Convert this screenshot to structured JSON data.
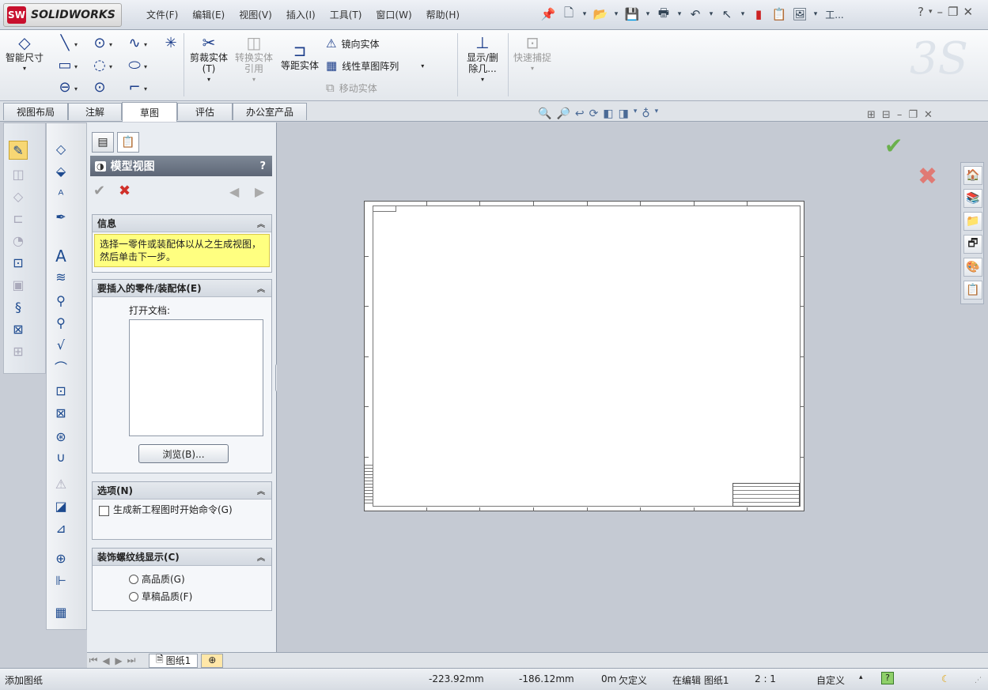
{
  "app": {
    "brand": "SOLIDWORKS",
    "logo_mark": "SW"
  },
  "menu": [
    "文件(F)",
    "编辑(E)",
    "视图(V)",
    "插入(I)",
    "工具(T)",
    "窗口(W)",
    "帮助(H)"
  ],
  "quick_access": {
    "pin_icon": "pin-icon",
    "overflow_label": "工..."
  },
  "ribbon": {
    "smart_dim": "智能尺寸",
    "trim": "剪裁实体(T)",
    "convert": "转换实体引用",
    "offset": "等距实体",
    "mirror": "镜向实体",
    "linear_pattern": "线性草图阵列",
    "move": "移动实体",
    "display_delete": "显示/删除几...",
    "quick_snap": "快速捕捉"
  },
  "tabs": [
    "视图布局",
    "注解",
    "草图",
    "评估",
    "办公室产品"
  ],
  "active_tab": "草图",
  "property_manager": {
    "title": "模型视图",
    "help": "?",
    "info": {
      "header": "信息",
      "text": "选择一零件或装配体以从之生成视图，然后单击下一步。"
    },
    "insert": {
      "header": "要插入的零件/装配体(E)",
      "open_docs_label": "打开文档:",
      "browse_label": "浏览(B)..."
    },
    "options": {
      "header": "选项(N)",
      "checkbox_label": "生成新工程图时开始命令(G)"
    },
    "thread": {
      "header": "装饰螺纹线显示(C)",
      "high": "高品质(G)",
      "draft": "草稿品质(F)"
    }
  },
  "sheet_tab": "图纸1",
  "status": {
    "message": "添加图纸",
    "x": "-223.92mm",
    "y": "-186.12mm",
    "z": "0m",
    "state": "欠定义",
    "editing": "在编辑 图纸1",
    "scale": "2 : 1",
    "units": "自定义",
    "help": "?"
  },
  "colors": {
    "accent": "#1b3d8a",
    "info_bg": "#ffff80",
    "confirm": "#6ab04c",
    "cancel": "#d0302a"
  }
}
